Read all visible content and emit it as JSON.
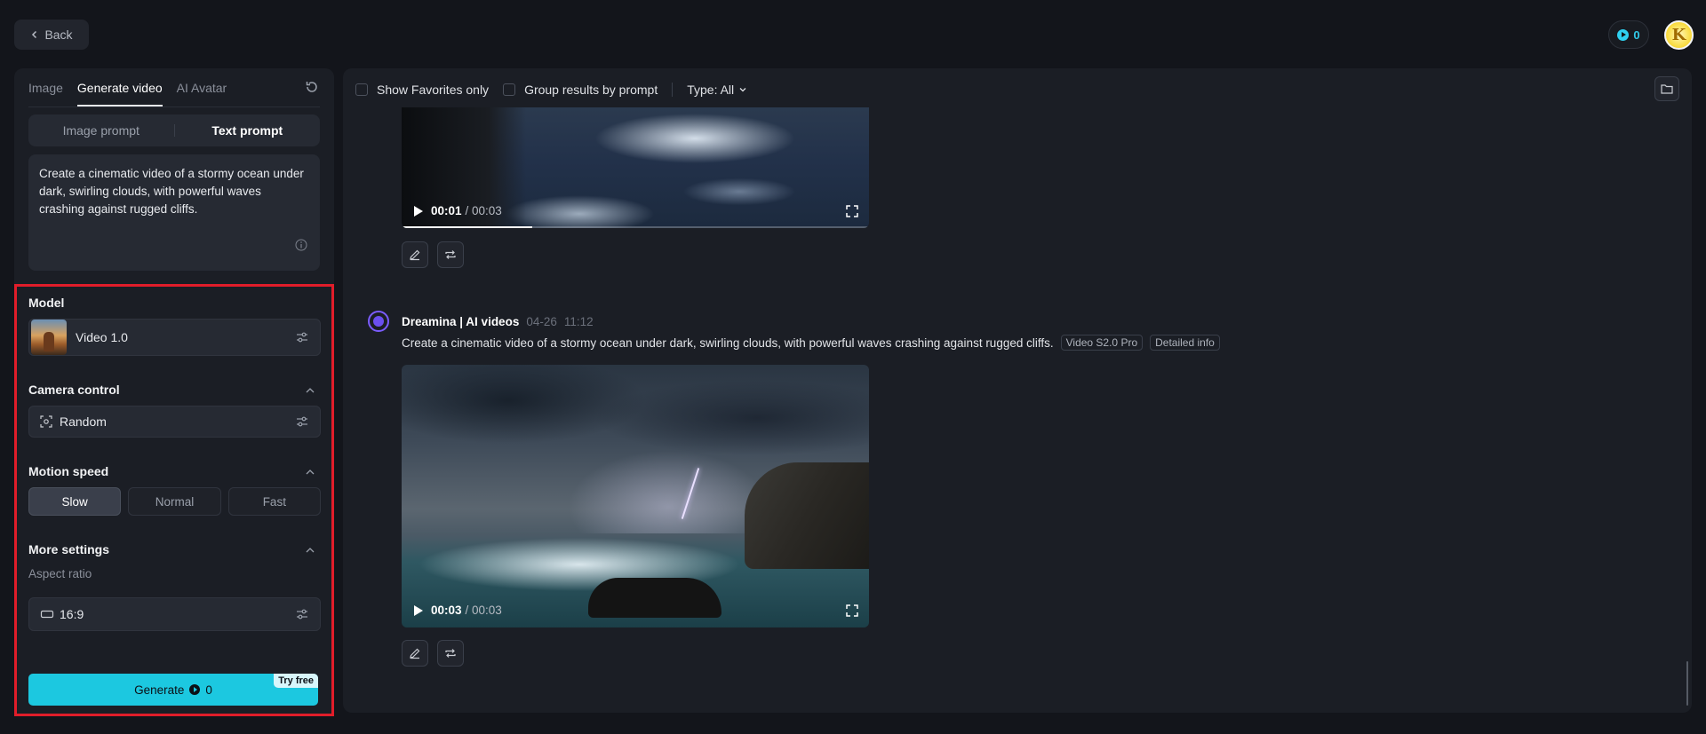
{
  "header": {
    "back_label": "Back",
    "credits": "0"
  },
  "left": {
    "tabs": [
      {
        "label": "Image",
        "active": false
      },
      {
        "label": "Generate video",
        "active": true
      },
      {
        "label": "AI Avatar",
        "active": false
      }
    ],
    "prompt_modes": [
      "Image prompt",
      "Text prompt"
    ],
    "active_prompt_mode": "Text prompt",
    "prompt_text": "Create a cinematic video of a stormy ocean under dark, swirling clouds, with powerful waves crashing against rugged cliffs.",
    "model": {
      "title": "Model",
      "value": "Video 1.0"
    },
    "camera": {
      "title": "Camera control",
      "value": "Random"
    },
    "motion": {
      "title": "Motion speed",
      "options": [
        "Slow",
        "Normal",
        "Fast"
      ],
      "selected": "Slow"
    },
    "more": {
      "title": "More settings",
      "aspect_label": "Aspect ratio",
      "aspect_value": "16:9"
    },
    "generate": {
      "label": "Generate",
      "cost": "0",
      "badge": "Try free"
    },
    "highlight_color": "#e11d2a",
    "accent_color": "#1cc8e0"
  },
  "right": {
    "filters": {
      "favorites": "Show Favorites only",
      "group": "Group results by prompt",
      "type": "Type: All"
    },
    "video1": {
      "current": "00:01",
      "duration": "/ 00:03",
      "progress": 0.28
    },
    "message": {
      "sender": "Dreamina | AI videos",
      "date": "04-26",
      "time": "11:12",
      "prompt": "Create a cinematic video of a stormy ocean under dark, swirling clouds, with powerful waves crashing against rugged cliffs.",
      "tags": [
        "Video S2.0 Pro",
        "Detailed info"
      ]
    },
    "video2": {
      "current": "00:03",
      "duration": "/ 00:03"
    }
  }
}
